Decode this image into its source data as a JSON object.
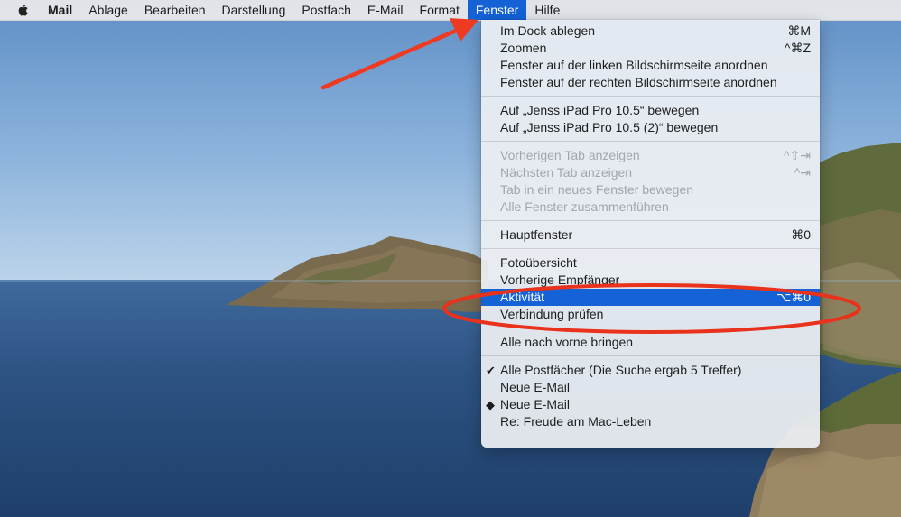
{
  "menubar": {
    "apple_icon": "apple-logo-icon",
    "app_name": "Mail",
    "items": [
      "Ablage",
      "Bearbeiten",
      "Darstellung",
      "Postfach",
      "E-Mail",
      "Format",
      "Fenster",
      "Hilfe"
    ],
    "active": "Fenster"
  },
  "window_menu": {
    "group1": [
      {
        "label": "Im Dock ablegen",
        "shortcut": "⌘M"
      },
      {
        "label": "Zoomen",
        "shortcut": "^⌘Z"
      },
      {
        "label": "Fenster auf der linken Bildschirmseite anordnen",
        "shortcut": ""
      },
      {
        "label": "Fenster auf der rechten Bildschirmseite anordnen",
        "shortcut": ""
      }
    ],
    "group2": [
      {
        "label": "Auf „Jenss iPad Pro 10.5“ bewegen"
      },
      {
        "label": "Auf „Jenss iPad Pro 10.5 (2)“ bewegen"
      }
    ],
    "group3": [
      {
        "label": "Vorherigen Tab anzeigen",
        "shortcut": "^⇧⇥",
        "enabled": false
      },
      {
        "label": "Nächsten Tab anzeigen",
        "shortcut": "^⇥",
        "enabled": false
      },
      {
        "label": "Tab in ein neues Fenster bewegen",
        "enabled": false
      },
      {
        "label": "Alle Fenster zusammenführen",
        "enabled": false
      }
    ],
    "group4": [
      {
        "label": "Hauptfenster",
        "shortcut": "⌘0"
      }
    ],
    "group5": [
      {
        "label": "Fotoübersicht"
      },
      {
        "label": "Vorherige Empfänger"
      },
      {
        "label": "Aktivität",
        "shortcut": "⌥⌘0",
        "highlighted": true
      },
      {
        "label": "Verbindung prüfen"
      }
    ],
    "group6": [
      {
        "label": "Alle nach vorne bringen"
      }
    ],
    "group7": [
      {
        "label": "Alle Postfächer (Die Suche ergab 5 Treffer)",
        "mark": "✔"
      },
      {
        "label": "Neue E-Mail",
        "mark": ""
      },
      {
        "label": "Neue E-Mail",
        "mark": "◆"
      },
      {
        "label": "Re: Freude am Mac-Leben",
        "mark": ""
      }
    ]
  },
  "annotations": {
    "arrow_color": "#ef3a22",
    "ellipse_color": "#e8321c"
  }
}
